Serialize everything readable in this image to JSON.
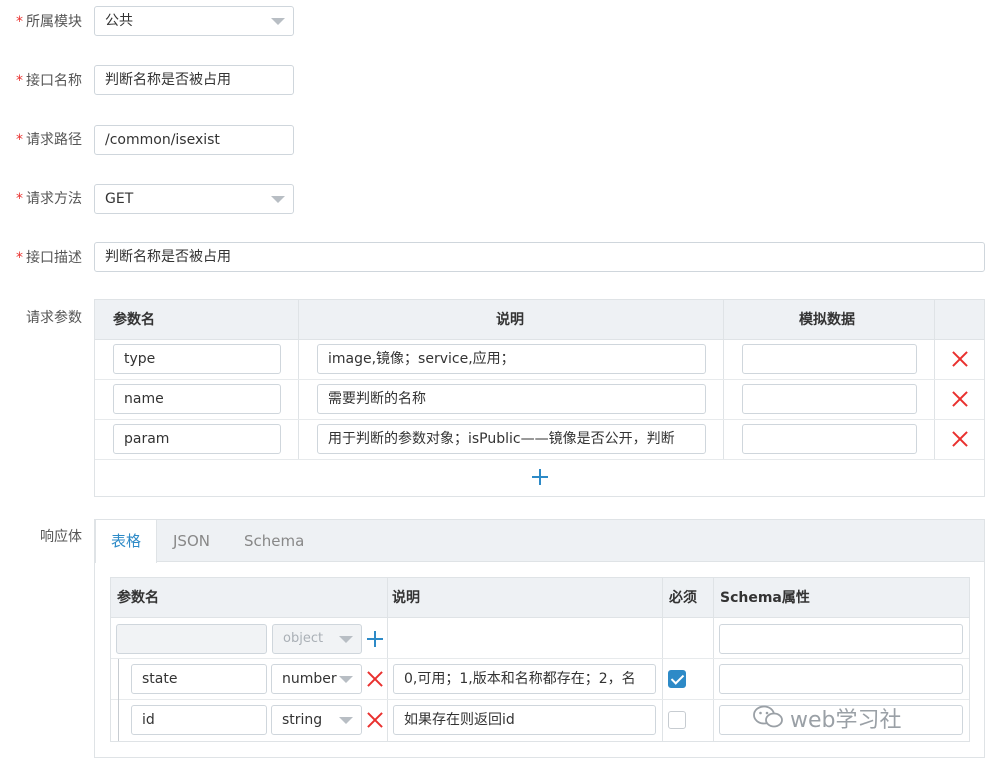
{
  "form": {
    "module": {
      "label": "所属模块",
      "value": "公共"
    },
    "name": {
      "label": "接口名称",
      "value": "判断名称是否被占用"
    },
    "path": {
      "label": "请求路径",
      "value": "/common/isexist"
    },
    "method": {
      "label": "请求方法",
      "value": "GET"
    },
    "desc": {
      "label": "接口描述",
      "value": "判断名称是否被占用"
    }
  },
  "request_params": {
    "label": "请求参数",
    "headers": {
      "name": "参数名",
      "desc": "说明",
      "mock": "模拟数据"
    },
    "rows": [
      {
        "name": "type",
        "desc": "image,镜像；service,应用；",
        "mock": ""
      },
      {
        "name": "name",
        "desc": "需要判断的名称",
        "mock": ""
      },
      {
        "name": "param",
        "desc": "用于判断的参数对象；isPublic——镜像是否公开，判断",
        "mock": ""
      }
    ]
  },
  "response": {
    "label": "响应体",
    "tabs": [
      "表格",
      "JSON",
      "Schema"
    ],
    "active_tab": "表格",
    "headers": {
      "name": "参数名",
      "desc": "说明",
      "required": "必须",
      "schema": "Schema属性"
    },
    "root": {
      "name": "",
      "type": "object"
    },
    "rows": [
      {
        "name": "state",
        "type": "number",
        "desc": "0,可用；1,版本和名称都存在；2，名",
        "required": true,
        "schema": ""
      },
      {
        "name": "id",
        "type": "string",
        "desc": "如果存在则返回id",
        "required": false,
        "schema": ""
      }
    ]
  },
  "watermark": {
    "text": "web学习社"
  },
  "colors": {
    "accent": "#2d8ac7",
    "danger": "#e9302e",
    "header_bg": "#eef1f4"
  }
}
